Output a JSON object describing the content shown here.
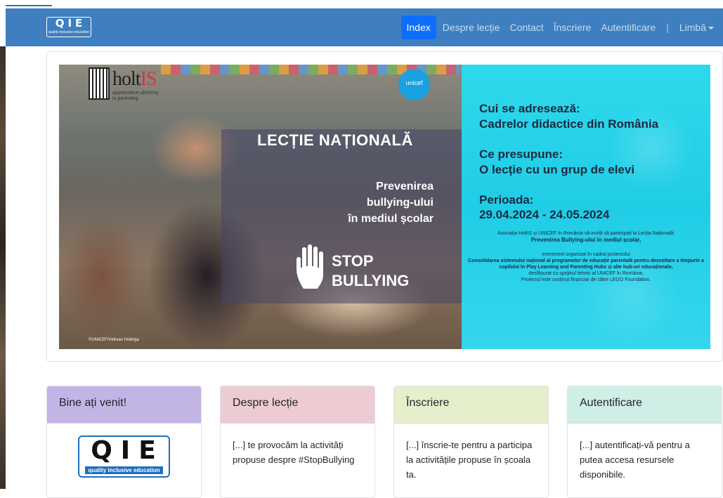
{
  "brand": {
    "letters": "QIE",
    "tagline": "quality inclusive education"
  },
  "nav": {
    "items": [
      "Index",
      "Despre lecție",
      "Contact",
      "Înscriere",
      "Autentificare"
    ],
    "separator": "|",
    "language": "Limbă"
  },
  "banner": {
    "org_logo": {
      "name": "holtIS",
      "name_prefix": "holt",
      "name_suffix": "IS",
      "tagline": "appreciative alchemy in parenting"
    },
    "unicef": "unicef",
    "lesson_title": "LECȚIE NAȚIONALĂ",
    "prevention": [
      "Prevenirea",
      "bullying-ului",
      "în mediul școlar"
    ],
    "stop": [
      "STOP",
      "BULLYING"
    ],
    "credit": "©UNICEF/Vidrean Holerga",
    "audience_label": "Cui se adresează:",
    "audience_value": "Cadrelor didactice din România",
    "requirement_label": "Ce presupune:",
    "requirement_value": "O lecție cu un grup de elevi",
    "period_label": "Perioada:",
    "period_value": "29.04.2024 - 24.05.2024",
    "invite_line1": "Asociația HoltIS și UNICEF în România vă invită să participați la Lecția Națională:",
    "invite_line2": "Prevenirea Bullying-ului în mediul școlar,",
    "project_intro": "eveniment organizat în cadrul proiectului",
    "project_text": "Consolidarea sistemului național al programelor de educație parentală pentru dezvoltare a timpurie a copilului în Play Learning and Parenting Hubs și alte hub-uri educaționale,",
    "support_line1": "desfășurat cu sprijinul tehnic al UNICEF în România.",
    "support_line2": "Proiectul este susținut financiar de către LEGO Foundation."
  },
  "cards": [
    {
      "title": "Bine ați venit!",
      "header_color": "#c3b4e6"
    },
    {
      "title": "Despre lecție",
      "header_color": "#edcbd2",
      "text": "[...] te provocăm la activități propuse despre #StopBullying"
    },
    {
      "title": "Înscriere",
      "header_color": "#e6efcb",
      "text": "[...] înscrie-te pentru a participa la activitățile propuse în școala ta."
    },
    {
      "title": "Autentificare",
      "header_color": "#cfeee6",
      "text": "[...] autentificați-vă pentru a putea accesa resursele disponibile."
    }
  ],
  "colors": {
    "navbar": "#3f7fc0",
    "active_nav": "#0d6efd",
    "info_panel": "#2fd9ec"
  }
}
